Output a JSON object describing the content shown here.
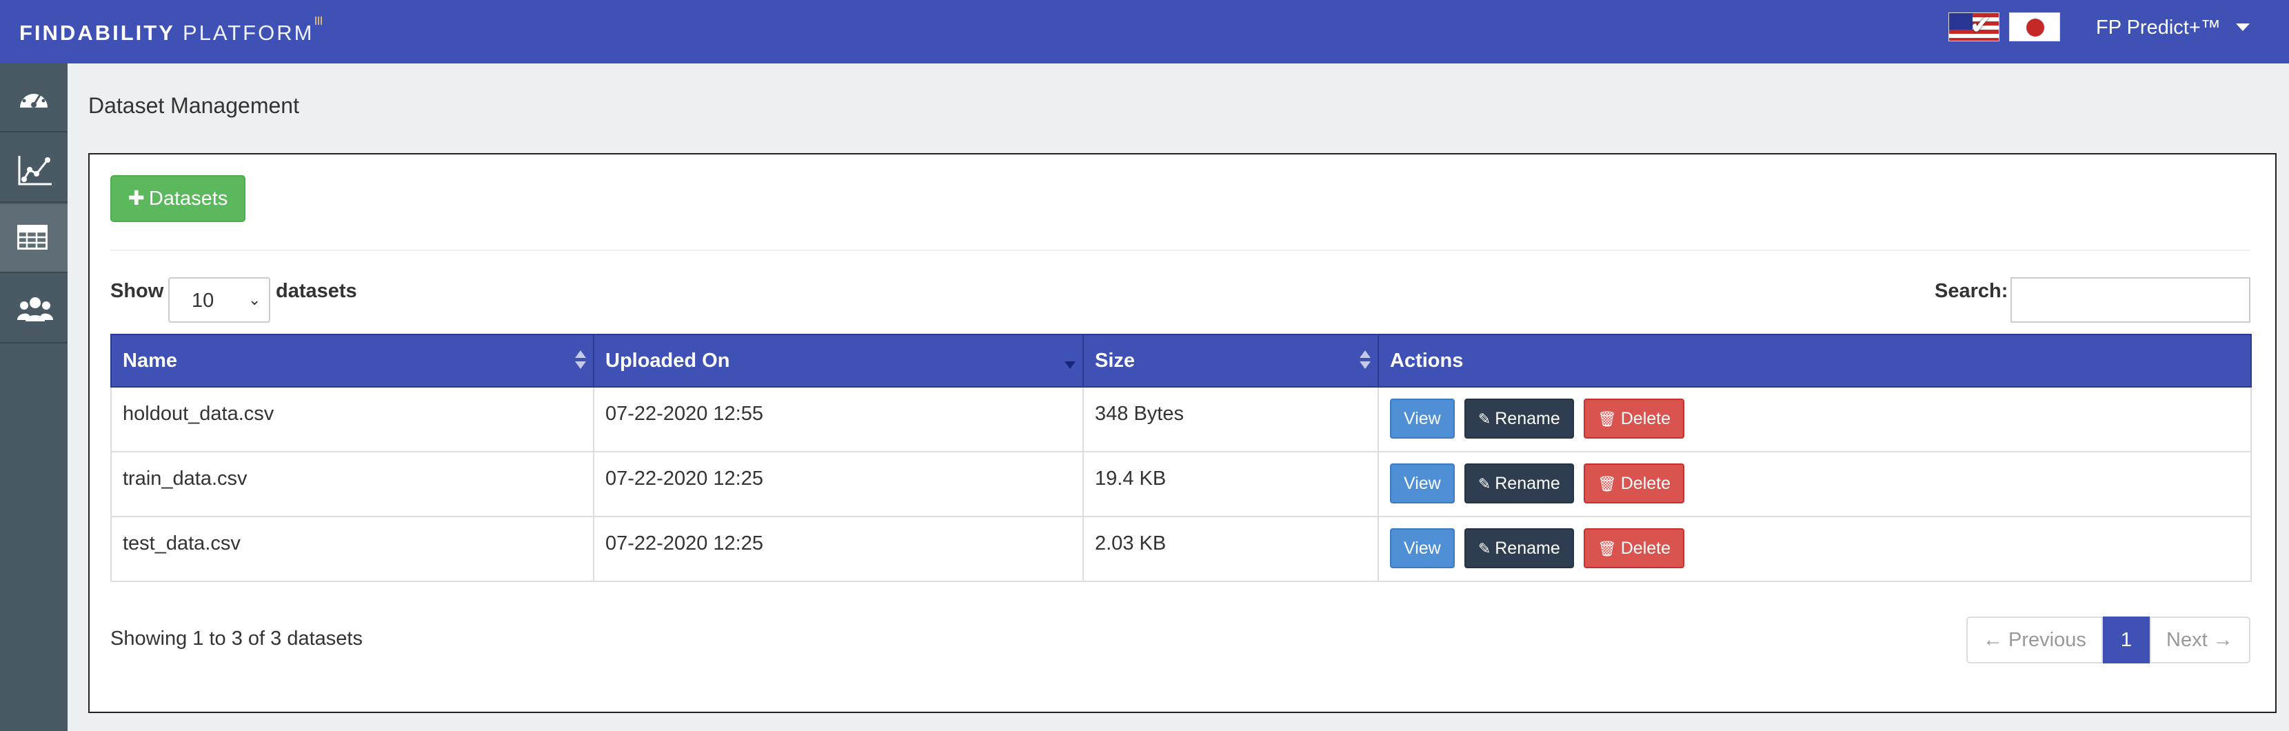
{
  "header": {
    "logo_bold": "FINDABILITY",
    "logo_light": "PLATFORM",
    "user_label": "FP Predict+™",
    "languages": [
      "en-flag-icon",
      "jp-flag-icon"
    ]
  },
  "sidebar": {
    "items": [
      {
        "icon": "dashboard-icon"
      },
      {
        "icon": "chart-icon"
      },
      {
        "icon": "table-icon",
        "active": true
      },
      {
        "icon": "users-icon"
      }
    ]
  },
  "main": {
    "title": "Dataset Management",
    "add_button": "Datasets",
    "show_label": "Show",
    "page_size": "10",
    "datasets_label": "datasets",
    "search_label": "Search:",
    "search_value": "",
    "columns": [
      "Name",
      "Uploaded On",
      "Size",
      "Actions"
    ],
    "rows": [
      {
        "name": "holdout_data.csv",
        "uploaded": "07-22-2020 12:55",
        "size": "348 Bytes"
      },
      {
        "name": "train_data.csv",
        "uploaded": "07-22-2020 12:25",
        "size": "19.4 KB"
      },
      {
        "name": "test_data.csv",
        "uploaded": "07-22-2020 12:25",
        "size": "2.03 KB"
      }
    ],
    "actions": {
      "view": "View",
      "rename": "Rename",
      "delete": "Delete"
    },
    "info": "Showing 1 to 3 of 3 datasets",
    "pager": {
      "previous": "← Previous",
      "current": "1",
      "next": "Next →"
    }
  },
  "colors": {
    "topbar": "#3f51b5",
    "sidebar": "#4a5a64",
    "add_button": "#5cb85c",
    "view_button": "#4e8fd6",
    "rename_button": "#2e3e50",
    "delete_button": "#d9534f"
  }
}
